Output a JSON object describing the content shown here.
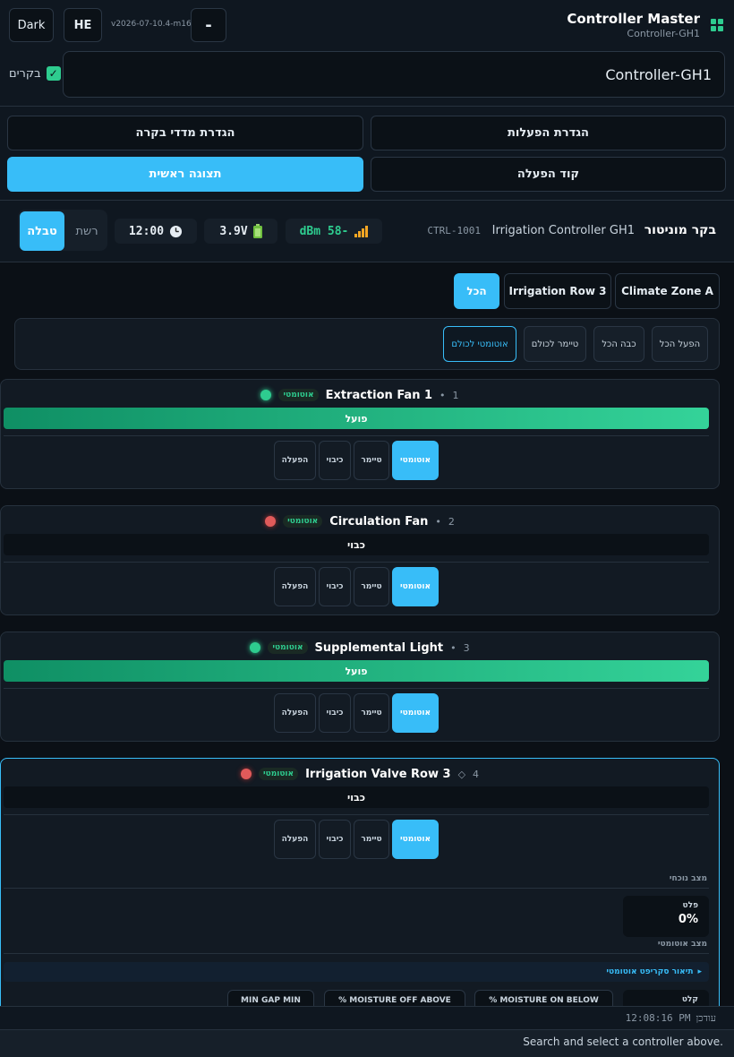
{
  "topbar": {
    "theme_label": "Dark",
    "lang_label": "HE",
    "version": "v2026-07-10.4-m16",
    "minus_label": "-",
    "brand_title": "Controller Master",
    "brand_subtitle": "Controller-GH1"
  },
  "search": {
    "value": "Controller-GH1",
    "checkbox_label": "בקרים",
    "checked": true
  },
  "nav": {
    "actuators_setup": "הגדרת הפעלות",
    "sensors_setup": "הגדרת מדדי בקרה",
    "activation_code": "קוד הפעלה",
    "main_view": "תצוגה ראשית"
  },
  "monitor": {
    "title": "בקר מוניטור",
    "controller_name": "Irrigation Controller GH1",
    "controller_id": "CTRL-1001",
    "signal": "dBm 58-",
    "battery": "3.9V",
    "time": "12:00",
    "view_table": "טבלה",
    "view_grid": "רשת"
  },
  "filters": [
    {
      "label": "Climate Zone A",
      "active": false
    },
    {
      "label": "Irrigation Row 3",
      "active": false
    },
    {
      "label": "הכל",
      "active": true
    }
  ],
  "bulk_actions": [
    {
      "label": "הפעל הכל",
      "selected": false
    },
    {
      "label": "כבה הכל",
      "selected": false
    },
    {
      "label": "טיימר לכולם",
      "selected": false
    },
    {
      "label": "אוטומטי לכולם",
      "selected": true
    }
  ],
  "modes": {
    "auto": "אוטומטי",
    "timer": "טיימר",
    "off": "כיבוי",
    "on": "הפעלה"
  },
  "auto_badge": "אוטומטי",
  "devices": [
    {
      "index": "1",
      "marker": "•",
      "name": "Extraction Fan 1",
      "led": "on",
      "status": "פועל"
    },
    {
      "index": "2",
      "marker": "•",
      "name": "Circulation Fan",
      "led": "off",
      "status": "כבוי"
    },
    {
      "index": "3",
      "marker": "•",
      "name": "Supplemental Light",
      "led": "on",
      "status": "פועל"
    },
    {
      "index": "4",
      "marker": "◇",
      "name": "Irrigation Valve Row 3",
      "led": "off",
      "status": "כבוי"
    }
  ],
  "detail": {
    "current_state_label": "מצב נוכחי",
    "output_label": "פלט",
    "output_value": "0%",
    "auto_state_label": "מצב אוטומטי",
    "script_label": "תיאור סקריפט אוטומטי",
    "input_label": "קלט",
    "params": [
      "% MOISTURE ON BELOW",
      "% MOISTURE OFF ABOVE",
      "MIN GAP MIN"
    ]
  },
  "updated": {
    "label": "עודכן",
    "time": "12:08:16 PM"
  },
  "footer": {
    "hint": "Search and select a controller above."
  },
  "colors": {
    "accent": "#38bdf8",
    "on_green": "#2ecc8f",
    "off_red": "#e05a5a",
    "background": "#0f1720"
  }
}
